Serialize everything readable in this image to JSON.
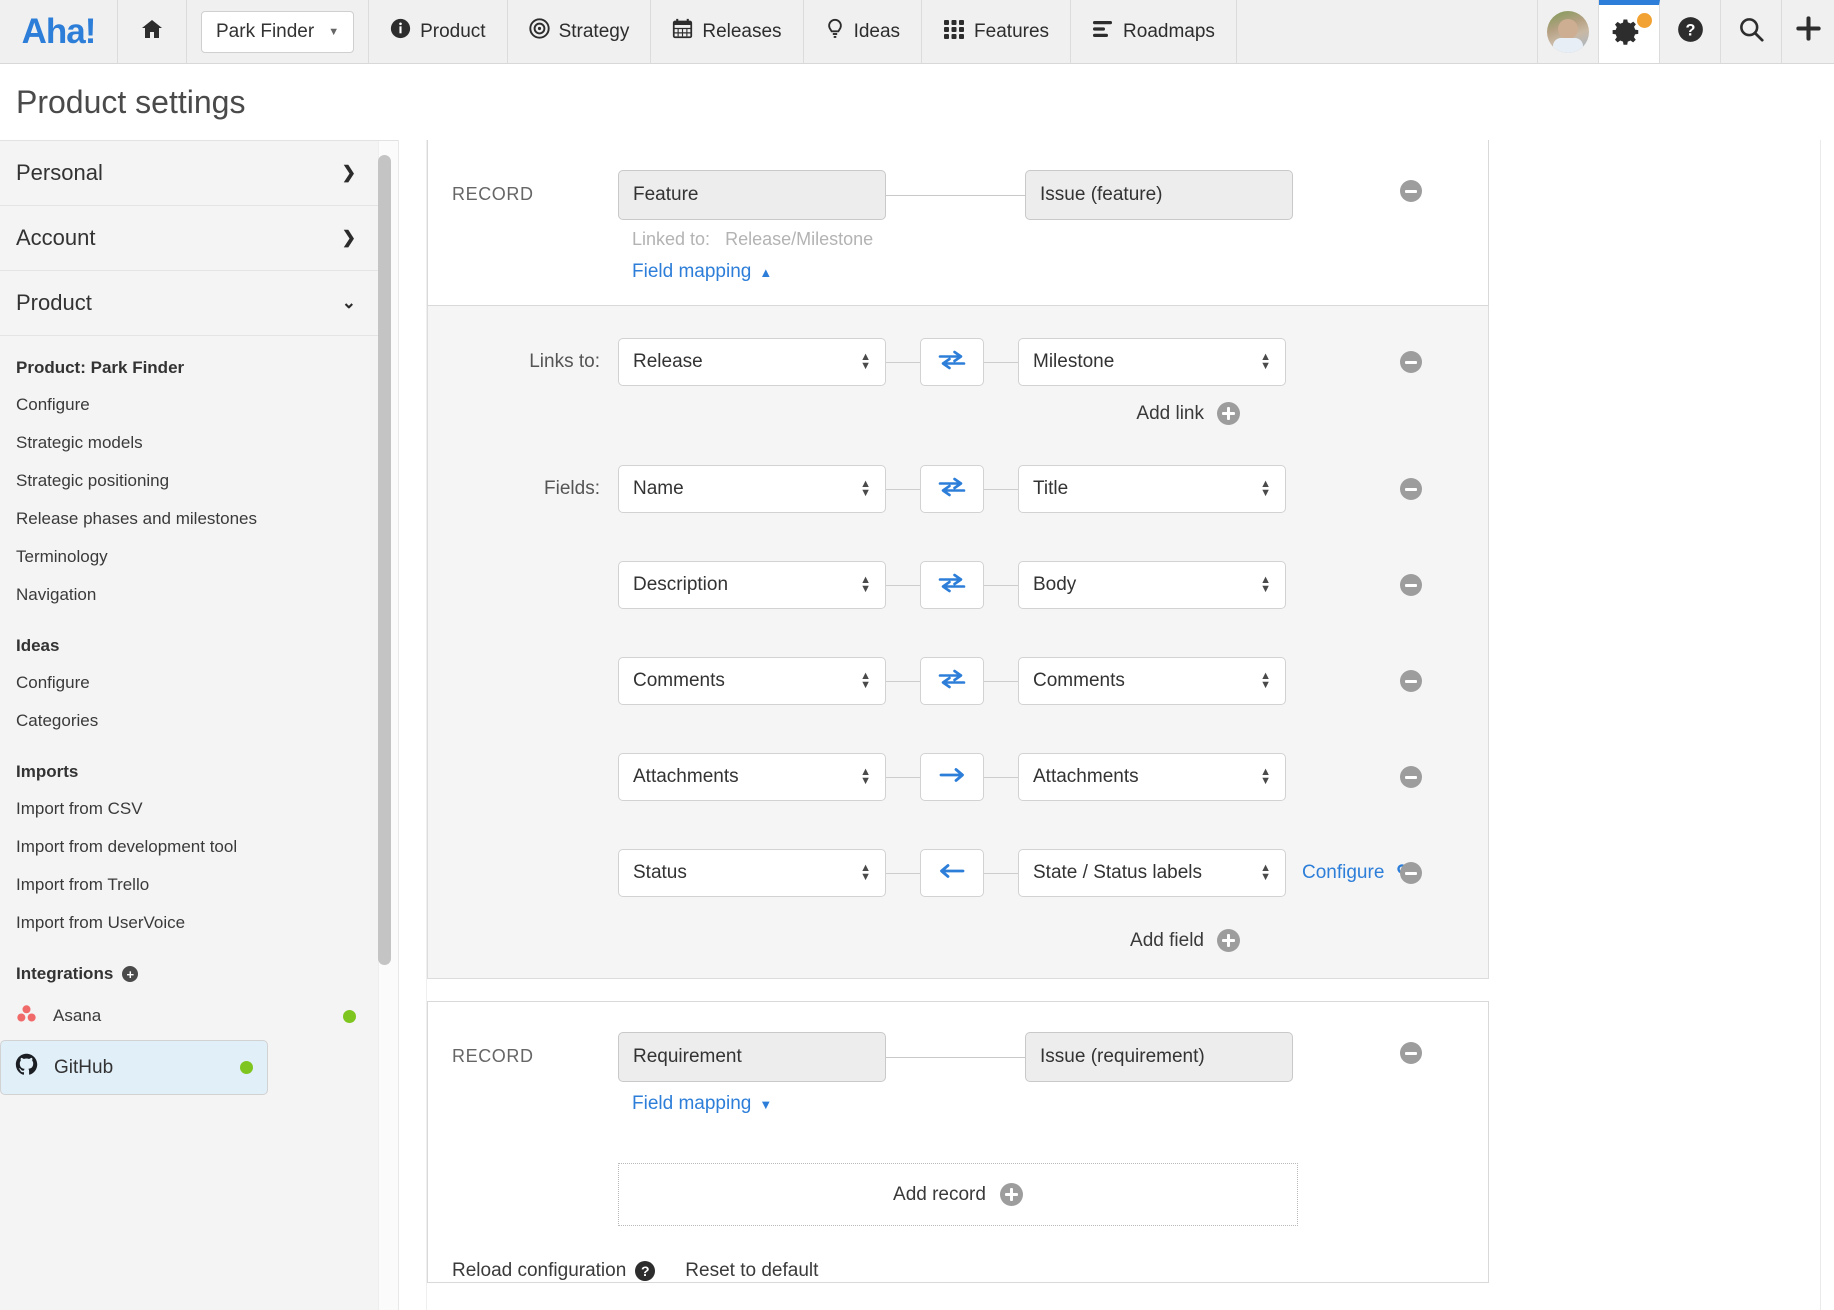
{
  "topnav": {
    "logo": "Aha!",
    "product_selector": {
      "label": "Park Finder",
      "caret": "caret-down-icon"
    },
    "items": [
      {
        "label": "Product",
        "icon": "info-circle-icon"
      },
      {
        "label": "Strategy",
        "icon": "target-icon"
      },
      {
        "label": "Releases",
        "icon": "calendar-icon"
      },
      {
        "label": "Ideas",
        "icon": "lightbulb-icon"
      },
      {
        "label": "Features",
        "icon": "grid-icon"
      },
      {
        "label": "Roadmaps",
        "icon": "roadmap-icon"
      }
    ],
    "right_icons": [
      {
        "name": "avatar"
      },
      {
        "name": "gear-icon",
        "active": true,
        "badge": true
      },
      {
        "name": "help-icon"
      },
      {
        "name": "search-icon"
      },
      {
        "name": "plus-icon"
      }
    ],
    "accent_color": "#2d7ed9",
    "badge_color": "#f2a233"
  },
  "page": {
    "title": "Product settings"
  },
  "sidebar": {
    "top_items": [
      {
        "label": "Personal",
        "chevron": "chevron-right-icon"
      },
      {
        "label": "Account",
        "chevron": "chevron-right-icon"
      },
      {
        "label": "Product",
        "chevron": "chevron-down-icon"
      }
    ],
    "groups": [
      {
        "heading": "Product: Park Finder",
        "links": [
          "Configure",
          "Strategic models",
          "Strategic positioning",
          "Release phases and milestones",
          "Terminology",
          "Navigation"
        ]
      },
      {
        "heading": "Ideas",
        "links": [
          "Configure",
          "Categories"
        ]
      },
      {
        "heading": "Imports",
        "links": [
          "Import from CSV",
          "Import from development tool",
          "Import from Trello",
          "Import from UserVoice"
        ]
      }
    ],
    "integrations": {
      "heading": "Integrations",
      "add_icon": "plus-circle-icon",
      "items": [
        {
          "label": "Asana",
          "status_color": "#7ec61f",
          "selected": false
        },
        {
          "label": "GitHub",
          "status_color": "#7ec61f",
          "selected": true
        }
      ]
    }
  },
  "main": {
    "records": [
      {
        "record_label": "RECORD",
        "left": "Feature",
        "right": "Issue (feature)",
        "linked_to_label": "Linked to:",
        "linked_to_value": "Release/Milestone",
        "field_mapping_label": "Field mapping",
        "field_mapping_caret": "caret-up-icon",
        "expanded": true,
        "mapping": {
          "links_label": "Links to:",
          "links": [
            {
              "left": "Release",
              "direction": "bidirectional",
              "right": "Milestone"
            }
          ],
          "add_link_label": "Add link",
          "fields_label": "Fields:",
          "fields": [
            {
              "left": "Name",
              "direction": "bidirectional",
              "right": "Title"
            },
            {
              "left": "Description",
              "direction": "bidirectional",
              "right": "Body"
            },
            {
              "left": "Comments",
              "direction": "bidirectional",
              "right": "Comments"
            },
            {
              "left": "Attachments",
              "direction": "right",
              "right": "Attachments"
            },
            {
              "left": "Status",
              "direction": "left",
              "right": "State / Status labels",
              "configure_label": "Configure",
              "configure_icon": "gears-icon"
            }
          ],
          "add_field_label": "Add field"
        }
      },
      {
        "record_label": "RECORD",
        "left": "Requirement",
        "right": "Issue (requirement)",
        "field_mapping_label": "Field mapping",
        "field_mapping_caret": "caret-down-icon",
        "expanded": false
      }
    ],
    "add_record_label": "Add record",
    "footer": {
      "reload_label": "Reload configuration",
      "reload_help_icon": "question-circle-icon",
      "reset_label": "Reset to default"
    }
  }
}
